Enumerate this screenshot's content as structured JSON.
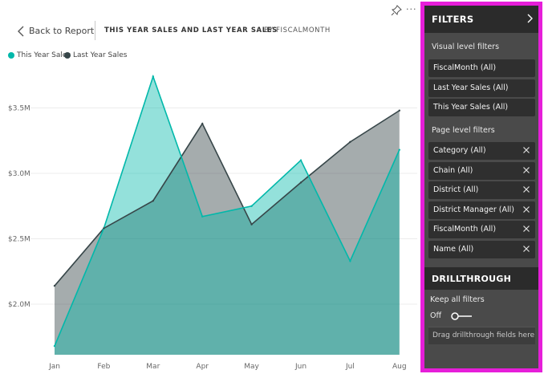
{
  "header": {
    "back_label": "Back to Report",
    "title": "THIS YEAR SALES AND LAST YEAR SALES",
    "subtitle": "BY FISCALMONTH",
    "pin_icon": "pin-icon",
    "more_icon": "more-options-icon",
    "more_glyph": "···"
  },
  "chart_data": {
    "type": "area",
    "categories": [
      "Jan",
      "Feb",
      "Mar",
      "Apr",
      "May",
      "Jun",
      "Jul",
      "Aug"
    ],
    "series": [
      {
        "name": "This Year Sales",
        "values": [
          1.68,
          2.58,
          3.74,
          2.67,
          2.75,
          3.1,
          2.33,
          3.18
        ],
        "color": "#01b8aa"
      },
      {
        "name": "Last Year Sales",
        "values": [
          2.14,
          2.58,
          2.79,
          3.38,
          2.61,
          2.93,
          3.24,
          3.48
        ],
        "color": "#374649"
      }
    ],
    "y_ticks": [
      2.0,
      2.5,
      3.0,
      3.5
    ],
    "y_tick_labels": [
      "$2.0M",
      "$2.5M",
      "$3.0M",
      "$3.5M"
    ],
    "ylim": [
      1.55,
      3.85
    ],
    "ylabel": "",
    "xlabel": "",
    "grid": true,
    "legend_position": "top-left"
  },
  "filters": {
    "title": "FILTERS",
    "collapse_icon": "chevron-right-icon",
    "visual_section": "Visual level filters",
    "visual_filters": [
      "FiscalMonth  (All)",
      "Last Year Sales  (All)",
      "This Year Sales  (All)"
    ],
    "page_section": "Page level filters",
    "page_filters": [
      "Category  (All)",
      "Chain  (All)",
      "District  (All)",
      "District Manager  (All)",
      "FiscalMonth  (All)",
      "Name  (All)"
    ],
    "drill_title": "DRILLTHROUGH",
    "keep_label": "Keep all filters",
    "toggle_state": "Off",
    "drag_label": "Drag drillthrough fields here"
  },
  "colors": {
    "accent_border": "#e61ed9",
    "pane_background": "#4a4a4a",
    "this_year": "#01b8aa",
    "last_year": "#374649"
  }
}
